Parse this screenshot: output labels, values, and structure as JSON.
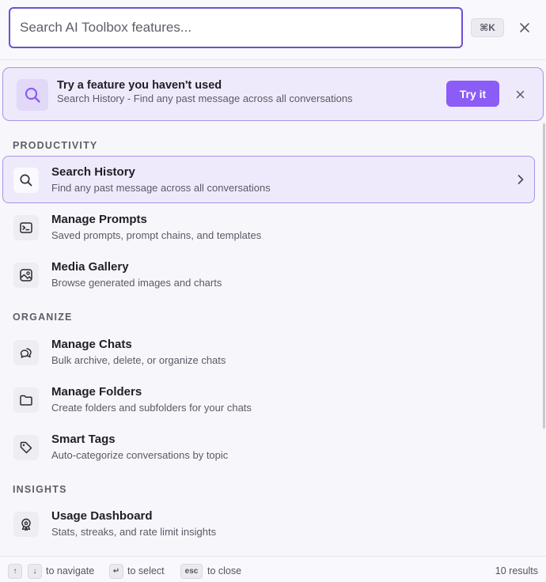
{
  "search": {
    "placeholder": "Search AI Toolbox features...",
    "value": ""
  },
  "shortcut": "⌘K",
  "banner": {
    "title": "Try a feature you haven't used",
    "description": "Search History - Find any past message across all conversations",
    "button_label": "Try it"
  },
  "sections": [
    {
      "header": "PRODUCTIVITY",
      "items": [
        {
          "icon": "search-icon",
          "title": "Search History",
          "description": "Find any past message across all conversations",
          "selected": true
        },
        {
          "icon": "prompt-terminal-icon",
          "title": "Manage Prompts",
          "description": "Saved prompts, prompt chains, and templates"
        },
        {
          "icon": "image-gallery-icon",
          "title": "Media Gallery",
          "description": "Browse generated images and charts"
        }
      ]
    },
    {
      "header": "ORGANIZE",
      "items": [
        {
          "icon": "chat-bubbles-icon",
          "title": "Manage Chats",
          "description": "Bulk archive, delete, or organize chats"
        },
        {
          "icon": "folder-icon",
          "title": "Manage Folders",
          "description": "Create folders and subfolders for your chats"
        },
        {
          "icon": "tag-icon",
          "title": "Smart Tags",
          "description": "Auto-categorize conversations by topic"
        }
      ]
    },
    {
      "header": "INSIGHTS",
      "items": [
        {
          "icon": "badge-award-icon",
          "title": "Usage Dashboard",
          "description": "Stats, streaks, and rate limit insights"
        }
      ]
    }
  ],
  "footer": {
    "up_key": "↑",
    "down_key": "↓",
    "navigate_label": "to navigate",
    "enter_key": "↵",
    "select_label": "to select",
    "esc_key": "esc",
    "close_label": "to close",
    "results": "10 results"
  },
  "colors": {
    "accent": "#8b5cf6",
    "focus_border": "#6d4fd6",
    "highlight_bg": "#efeafb"
  }
}
